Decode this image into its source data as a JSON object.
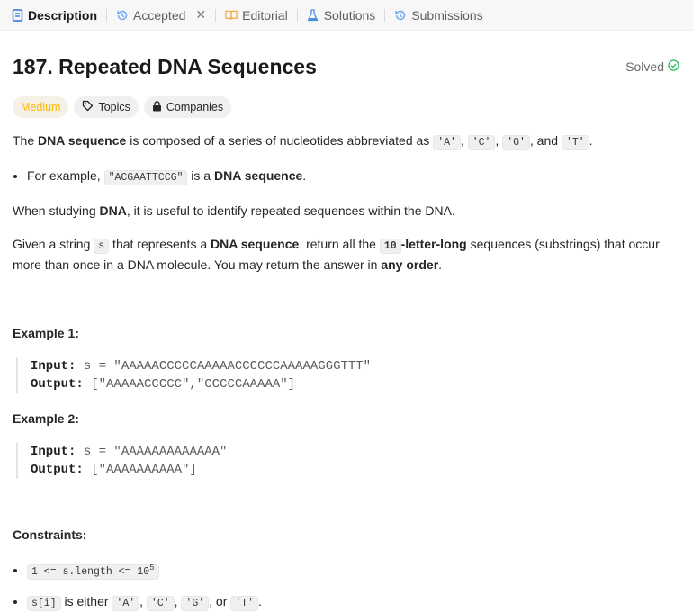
{
  "tabs": [
    {
      "label": "Description",
      "icon": "description-icon"
    },
    {
      "label": "Accepted",
      "icon": "history-icon"
    },
    {
      "label": "Editorial",
      "icon": "book-icon"
    },
    {
      "label": "Solutions",
      "icon": "flask-icon"
    },
    {
      "label": "Submissions",
      "icon": "history-icon"
    }
  ],
  "problem": {
    "title": "187. Repeated DNA Sequences",
    "status": "Solved",
    "tags": {
      "difficulty": "Medium",
      "topics": "Topics",
      "companies": "Companies"
    }
  },
  "desc": {
    "p1": {
      "t1": "The ",
      "b1": "DNA sequence",
      "t2": " is composed of a series of nucleotides abbreviated as ",
      "c1": "'A'",
      "s1": ", ",
      "c2": "'C'",
      "s2": ", ",
      "c3": "'G'",
      "s3": ", and ",
      "c4": "'T'",
      "s4": "."
    },
    "bullet": {
      "t1": "For example, ",
      "c1": "\"ACGAATTCCG\"",
      "t2": " is a ",
      "b1": "DNA sequence",
      "t3": "."
    },
    "p2": {
      "t1": "When studying ",
      "b1": "DNA",
      "t2": ", it is useful to identify repeated sequences within the DNA."
    },
    "p3": {
      "t1": "Given a string ",
      "c1": "s",
      "t2": " that represents a ",
      "b1": "DNA sequence",
      "t3": ", return all the ",
      "c2": "10",
      "b2": "-letter-long",
      "t4": " sequences (substrings) that occur more than once in a DNA molecule. You may return the answer in ",
      "b3": "any order",
      "t5": "."
    }
  },
  "examples": [
    {
      "heading": "Example 1:",
      "input_label": "Input:",
      "input": " s = \"AAAAACCCCCAAAAACCCCCCAAAAAGGGTTT\"",
      "output_label": "Output:",
      "output": " [\"AAAAACCCCC\",\"CCCCCAAAAA\"]"
    },
    {
      "heading": "Example 2:",
      "input_label": "Input:",
      "input": " s = \"AAAAAAAAAAAAA\"",
      "output_label": "Output:",
      "output": " [\"AAAAAAAAAA\"]"
    }
  ],
  "constraints": {
    "heading": "Constraints:",
    "c1": {
      "code": "1 <= s.length <= 10",
      "sup": "5"
    },
    "c2": {
      "c1": "s[i]",
      "t1": " is either ",
      "c2": "'A'",
      "s1": ", ",
      "c3": "'C'",
      "s2": ", ",
      "c4": "'G'",
      "s3": ", or ",
      "c5": "'T'",
      "s4": "."
    }
  },
  "colors": {
    "medium": "#ffb800",
    "solved": "#2cbb5d",
    "accent": "#1a1a1a"
  }
}
